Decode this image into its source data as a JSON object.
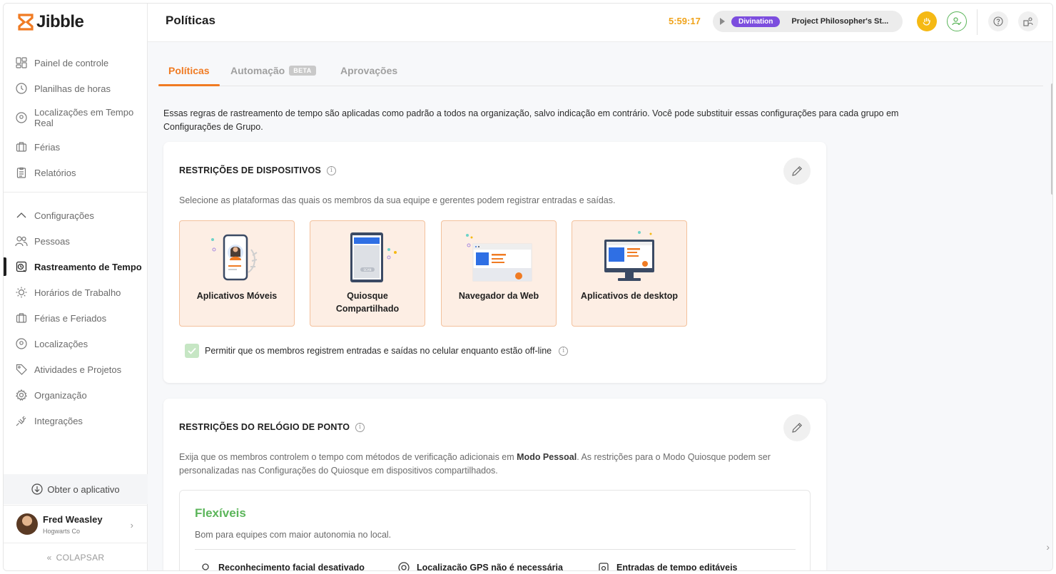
{
  "brand": {
    "name": "Jibble"
  },
  "sidebar": {
    "items": [
      {
        "label": "Painel de controle"
      },
      {
        "label": "Planilhas de horas"
      },
      {
        "label": "Localizações em Tempo Real"
      },
      {
        "label": "Férias"
      },
      {
        "label": "Relatórios"
      }
    ],
    "settings": [
      {
        "label": "Configurações"
      },
      {
        "label": "Pessoas"
      },
      {
        "label": "Rastreamento de Tempo"
      },
      {
        "label": "Horários de Trabalho"
      },
      {
        "label": "Férias e Feriados"
      },
      {
        "label": "Localizações"
      },
      {
        "label": "Atividades e Projetos"
      },
      {
        "label": "Organização"
      },
      {
        "label": "Integrações"
      }
    ],
    "get_app": "Obter o aplicativo",
    "user": {
      "name": "Fred Weasley",
      "org": "Hogwarts Co"
    },
    "collapse": "COLAPSAR"
  },
  "header": {
    "title": "Políticas",
    "timer": "5:59:17",
    "activity": "Divination",
    "project": "Project Philosopher's St..."
  },
  "tabs": [
    {
      "label": "Políticas"
    },
    {
      "label": "Automação",
      "badge": "BETA"
    },
    {
      "label": "Aprovações"
    }
  ],
  "intro": "Essas regras de rastreamento de tempo são aplicadas como padrão a todos na organização, salvo indicação em contrário. Você pode substituir essas configurações para cada grupo em Configurações de Grupo.",
  "device_card": {
    "title": "RESTRIÇÕES DE DISPOSITIVOS",
    "description": "Selecione as plataformas das quais os membros da sua equipe e gerentes podem registrar entradas e saídas.",
    "platforms": [
      {
        "label": "Aplicativos Móveis"
      },
      {
        "label": "Quiosque Compartilhado"
      },
      {
        "label": "Navegador da Web"
      },
      {
        "label": "Aplicativos de desktop"
      }
    ],
    "kiosk_scan_text": "SCAN",
    "offline_label": "Permitir que os membros registrem entradas e saídas no celular enquanto estão off-line",
    "offline_checked": true
  },
  "clock_card": {
    "title": "RESTRIÇÕES DO RELÓGIO DE PONTO",
    "description_pre": "Exija que os membros controlem o tempo com métodos de verificação adicionais em ",
    "description_bold": "Modo Pessoal",
    "description_post": ". As restrições para o Modo Quiosque podem ser personalizadas nas Configurações do Quiosque em dispositivos compartilhados.",
    "preset": {
      "title": "Flexíveis",
      "description": "Bom para equipes com maior autonomia no local.",
      "features": [
        {
          "label": "Reconhecimento facial desativado"
        },
        {
          "label": "Localização GPS não é necessária"
        },
        {
          "label": "Entradas de tempo editáveis"
        }
      ]
    }
  },
  "colors": {
    "accent": "#f07b23",
    "timer": "#f0a31b",
    "activity": "#7c4dde",
    "success": "#5bb55a"
  }
}
